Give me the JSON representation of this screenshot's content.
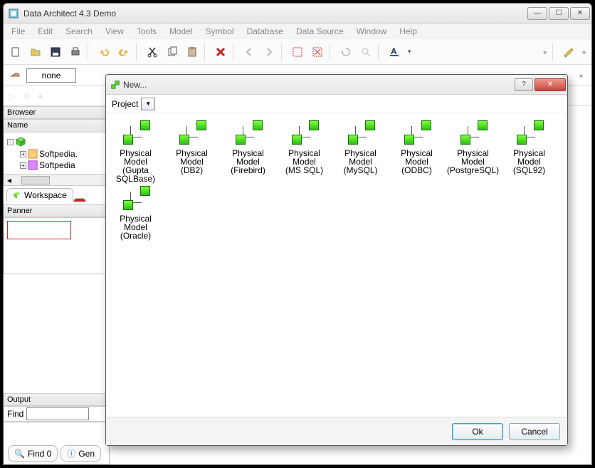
{
  "window": {
    "title": "Data Architect 4.3 Demo",
    "buttons": {
      "min": "—",
      "max": "☐",
      "close": "✕"
    }
  },
  "menubar": [
    "File",
    "Edit",
    "Search",
    "View",
    "Tools",
    "Model",
    "Symbol",
    "Database",
    "Data Source",
    "Window",
    "Help"
  ],
  "toolbar_icons": [
    "new-icon",
    "open-icon",
    "save-icon",
    "print-icon",
    "undo-icon",
    "redo-icon",
    "cut-icon",
    "copy-icon",
    "paste-icon",
    "delete-icon",
    "back-icon",
    "forward-icon",
    "select-all-icon",
    "deselect-icon",
    "refresh-icon",
    "zoom-icon",
    "font-color-icon",
    "overflow-icon",
    "format-icon"
  ],
  "mode": {
    "label": "none"
  },
  "browser": {
    "title": "Browser",
    "name_header": "Name",
    "items": [
      "Softpedia.",
      "Softpedia"
    ]
  },
  "tabs": {
    "workspace": "Workspace"
  },
  "panner": {
    "title": "Panner"
  },
  "output": {
    "title": "Output",
    "find_label": "Find"
  },
  "bottom_tabs": {
    "find": "Find 0",
    "gen": "Gen"
  },
  "dialog": {
    "title": "New...",
    "project_label": "Project",
    "ok": "Ok",
    "cancel": "Cancel",
    "help": "?",
    "close": "✕",
    "items": [
      {
        "l1": "Physical Model",
        "l2": "(Gupta SQLBase)"
      },
      {
        "l1": "Physical Model",
        "l2": "(DB2)"
      },
      {
        "l1": "Physical Model",
        "l2": "(Firebird)"
      },
      {
        "l1": "Physical Model",
        "l2": "(MS SQL)"
      },
      {
        "l1": "Physical Model",
        "l2": "(MySQL)"
      },
      {
        "l1": "Physical Model",
        "l2": "(ODBC)"
      },
      {
        "l1": "Physical Model",
        "l2": "(PostgreSQL)"
      },
      {
        "l1": "Physical Model",
        "l2": "(SQL92)"
      },
      {
        "l1": "Physical Model",
        "l2": "(Oracle)"
      }
    ]
  }
}
